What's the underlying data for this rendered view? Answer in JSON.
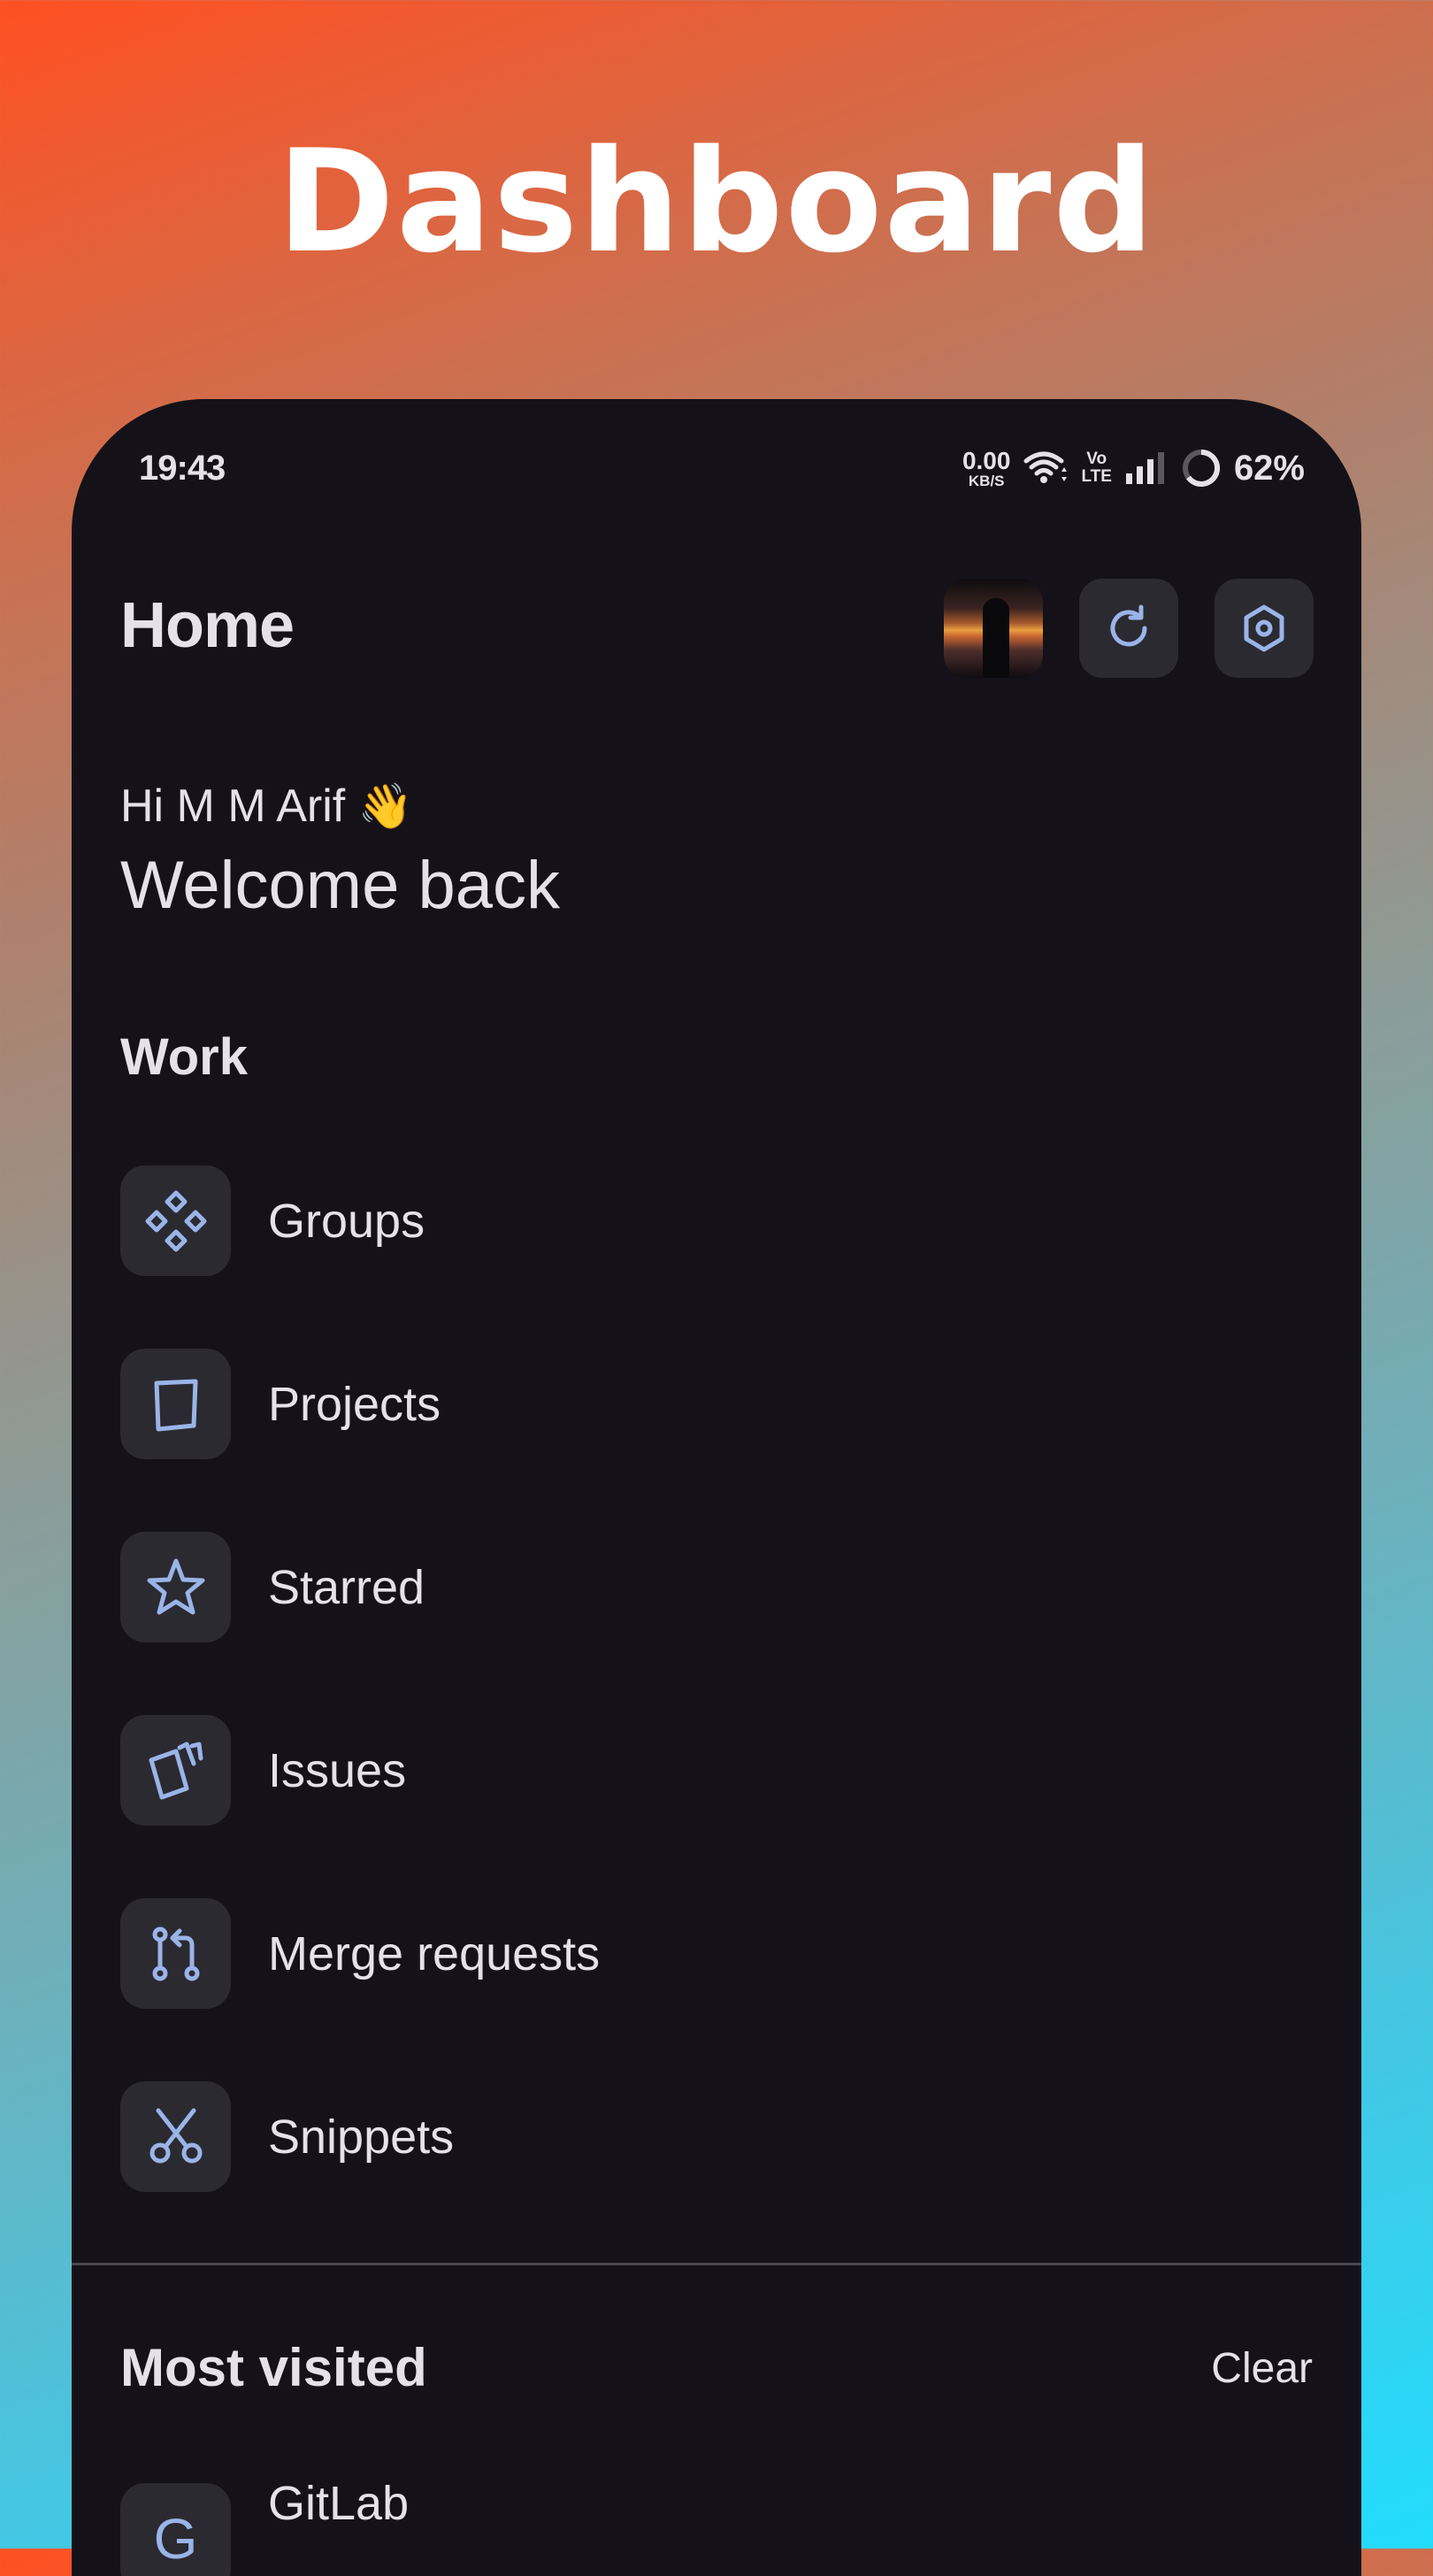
{
  "promo": {
    "title": "Dashboard"
  },
  "status_bar": {
    "time": "19:43",
    "net_speed_value": "0.00",
    "net_speed_unit": "KB/S",
    "volte_top": "Vo",
    "volte_bottom": "LTE",
    "battery": "62%"
  },
  "app_bar": {
    "title": "Home"
  },
  "greeting": {
    "hi": "Hi M M Arif",
    "emoji": "👋",
    "welcome": "Welcome back"
  },
  "work": {
    "title": "Work",
    "items": [
      {
        "label": "Groups",
        "icon": "groups-icon"
      },
      {
        "label": "Projects",
        "icon": "projects-icon"
      },
      {
        "label": "Starred",
        "icon": "star-icon"
      },
      {
        "label": "Issues",
        "icon": "issues-icon"
      },
      {
        "label": "Merge requests",
        "icon": "merge-request-icon"
      },
      {
        "label": "Snippets",
        "icon": "scissors-icon"
      }
    ]
  },
  "most_visited": {
    "title": "Most visited",
    "clear_label": "Clear",
    "items": [
      {
        "label": "GitLab",
        "initial": "G"
      }
    ]
  },
  "colors": {
    "background_top": "#ff5022",
    "background_bottom": "#22dcfd",
    "surface": "#141218",
    "icon_container": "#2b2a31",
    "icon_accent": "#9ab4e8",
    "text_primary": "#e6e1e9"
  }
}
